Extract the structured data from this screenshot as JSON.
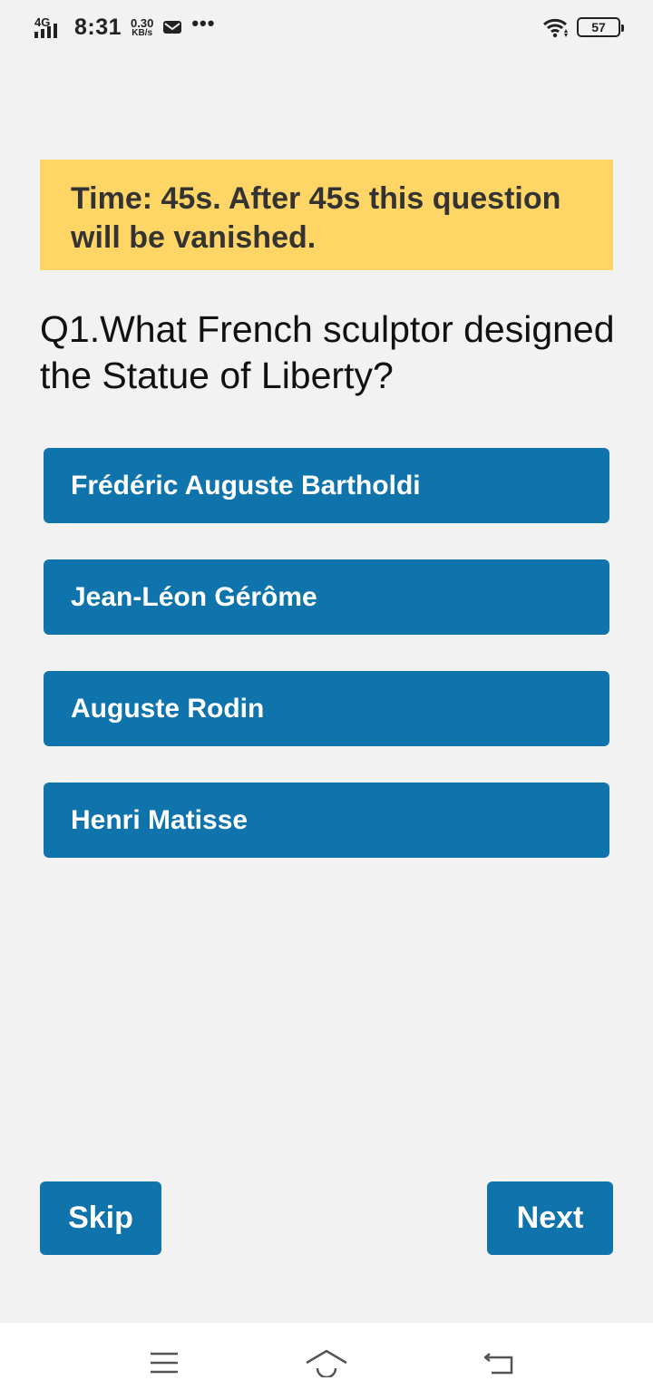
{
  "status_bar": {
    "network": "4G",
    "time": "8:31",
    "speed_value": "0.30",
    "speed_unit": "KB/s",
    "more": "•••",
    "battery": "57",
    "icons": [
      "signal-icon",
      "mail-icon",
      "wifi-icon",
      "battery-icon"
    ]
  },
  "quiz": {
    "timer_text": "Time: 45s. After 45s this question will be vanished.",
    "question": "Q1.What French sculptor designed the Statue of Liberty?",
    "options": [
      "Frédéric Auguste Bartholdi",
      "Jean-Léon Gérôme",
      "Auguste Rodin",
      "Henri Matisse"
    ],
    "skip_label": "Skip",
    "next_label": "Next"
  },
  "colors": {
    "background": "#f2f2f2",
    "banner": "#ffd666",
    "primary": "#0f73ac"
  },
  "nav_bar": {
    "icons": [
      "menu-icon",
      "home-icon",
      "back-icon"
    ]
  }
}
